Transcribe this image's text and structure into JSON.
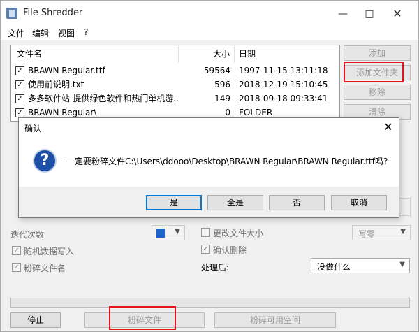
{
  "window": {
    "title": "File Shredder"
  },
  "menu": [
    "文件",
    "编辑",
    "视图",
    "?"
  ],
  "file_list": {
    "headers": {
      "name": "文件名",
      "size": "大小",
      "date": "日期"
    },
    "rows": [
      {
        "name": "BRAWN Regular.ttf",
        "size": "59564",
        "date": "1997-11-15 13:11:18",
        "checked": true
      },
      {
        "name": "使用前说明.txt",
        "size": "596",
        "date": "2018-12-19 15:10:45",
        "checked": true
      },
      {
        "name": "多多软件站-提供绿色软件和热门单机游...",
        "size": "149",
        "date": "2018-09-18 09:33:41",
        "checked": true
      },
      {
        "name": "BRAWN Regular\\",
        "size": "0",
        "date": "FOLDER",
        "checked": true
      }
    ]
  },
  "side_buttons": [
    "添加",
    "添加文件夹",
    "移除",
    "清除"
  ],
  "dialog": {
    "title": "确认",
    "message": "一定要粉碎文件C:\\Users\\ddooo\\Desktop\\BRAWN Regular\\BRAWN Regular.ttf吗?",
    "buttons": [
      "是",
      "全是",
      "否",
      "取消"
    ]
  },
  "options": {
    "iterations_label": "迭代次数",
    "random_data_label": "随机数据写入",
    "shred_names_label": "粉碎文件名",
    "change_size_label": "更改文件大小",
    "confirm_delete_label": "确认删除",
    "after_label": "处理后:",
    "after_value": "没做什么",
    "write_zero_label": "写零"
  },
  "bottom": {
    "stop": "停止",
    "shred_files": "粉碎文件",
    "shred_free_space": "粉碎可用空间"
  },
  "colors": {
    "highlight_frame": "#e8141d",
    "default_button_border": "#0078d7"
  }
}
